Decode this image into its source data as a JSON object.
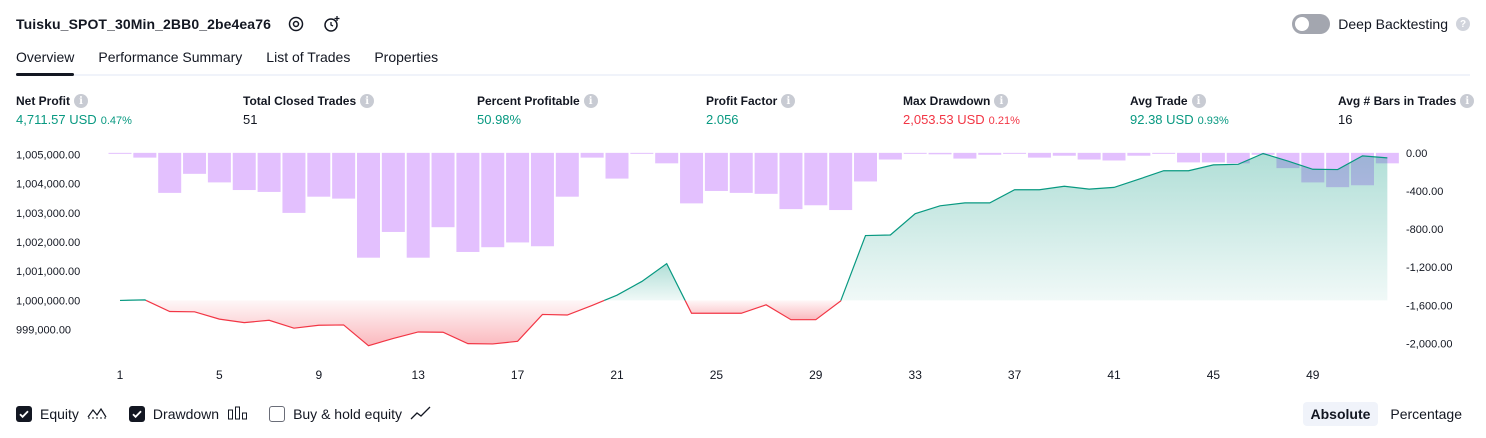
{
  "header": {
    "title": "Tuisku_SPOT_30Min_2BB0_2be4ea76",
    "deep_backtesting_label": "Deep Backtesting",
    "help_glyph": "?"
  },
  "tabs": [
    {
      "label": "Overview",
      "active": true
    },
    {
      "label": "Performance Summary"
    },
    {
      "label": "List of Trades"
    },
    {
      "label": "Properties"
    }
  ],
  "info_glyph": "i",
  "metrics": [
    {
      "label": "Net Profit",
      "value": "4,711.57 USD",
      "pct": "0.47%",
      "tone": "green"
    },
    {
      "label": "Total Closed Trades",
      "value": "51",
      "pct": "",
      "tone": "dark"
    },
    {
      "label": "Percent Profitable",
      "value": "50.98%",
      "pct": "",
      "tone": "green"
    },
    {
      "label": "Profit Factor",
      "value": "2.056",
      "pct": "",
      "tone": "green"
    },
    {
      "label": "Max Drawdown",
      "value": "2,053.53 USD",
      "pct": "0.21%",
      "tone": "red"
    },
    {
      "label": "Avg Trade",
      "value": "92.38 USD",
      "pct": "0.93%",
      "tone": "green"
    },
    {
      "label": "Avg # Bars in Trades",
      "value": "16",
      "pct": "",
      "tone": "dark"
    }
  ],
  "legend": {
    "equity": "Equity",
    "drawdown": "Drawdown",
    "buy_hold": "Buy & hold equity"
  },
  "modes": {
    "absolute": "Absolute",
    "percentage": "Percentage"
  },
  "colors": {
    "profit": "#089981",
    "loss": "#f23645",
    "drawdown_bar": "#ce93fe",
    "text": "#131722"
  },
  "chart_data": {
    "type": "line",
    "title": "",
    "x_ticks": [
      "1",
      "5",
      "9",
      "13",
      "17",
      "21",
      "25",
      "29",
      "33",
      "37",
      "41",
      "45",
      "49"
    ],
    "left_axis": {
      "ticks": [
        "1,005,000.00",
        "1,004,000.00",
        "1,003,000.00",
        "1,002,000.00",
        "1,001,000.00",
        "1,000,000.00",
        "999,000.00"
      ],
      "range": [
        998200,
        1005150
      ],
      "baseline": 1000000
    },
    "right_axis": {
      "ticks": [
        "0.00",
        "-400.00",
        "-800.00",
        "-1,200.00",
        "-1,600.00",
        "-2,000.00"
      ],
      "range": [
        -2100,
        30
      ]
    },
    "series": [
      {
        "name": "Equity",
        "axis": "left",
        "x": [
          1,
          2,
          3,
          4,
          5,
          6,
          7,
          8,
          9,
          10,
          11,
          12,
          13,
          14,
          15,
          16,
          17,
          18,
          19,
          20,
          21,
          22,
          23,
          24,
          25,
          26,
          27,
          28,
          29,
          30,
          31,
          32,
          33,
          34,
          35,
          36,
          37,
          38,
          39,
          40,
          41,
          42,
          43,
          44,
          45,
          46,
          47,
          48,
          49,
          50,
          51,
          52
        ],
        "values": [
          1000000,
          1000020,
          999620,
          999610,
          999360,
          999240,
          999320,
          999050,
          999150,
          999160,
          998450,
          998700,
          998920,
          998910,
          998520,
          998510,
          998600,
          999520,
          999500,
          999830,
          1000180,
          1000650,
          1001260,
          999560,
          999560,
          999560,
          999850,
          999340,
          999340,
          999980,
          1002220,
          1002240,
          1002970,
          1003240,
          1003340,
          1003340,
          1003790,
          1003790,
          1003910,
          1003810,
          1003870,
          1004150,
          1004440,
          1004440,
          1004640,
          1004660,
          1005030,
          1004770,
          1004490,
          1004480,
          1004950,
          1004880
        ]
      },
      {
        "name": "Drawdown",
        "axis": "right",
        "type": "bar",
        "x": [
          1,
          2,
          3,
          4,
          5,
          6,
          7,
          8,
          9,
          10,
          11,
          12,
          13,
          14,
          15,
          16,
          17,
          18,
          19,
          20,
          21,
          22,
          23,
          24,
          25,
          26,
          27,
          28,
          29,
          30,
          31,
          32,
          33,
          34,
          35,
          36,
          37,
          38,
          39,
          40,
          41,
          42,
          43,
          44,
          45,
          46,
          47,
          48,
          49,
          50,
          51,
          52
        ],
        "values": [
          0,
          -50,
          -420,
          -220,
          -310,
          -390,
          -410,
          -630,
          -460,
          -480,
          -1100,
          -830,
          -1100,
          -780,
          -1040,
          -990,
          -940,
          -980,
          -460,
          -50,
          -270,
          -5,
          -110,
          -530,
          -400,
          -420,
          -430,
          -590,
          -550,
          -600,
          -300,
          -70,
          0,
          -15,
          -60,
          -20,
          -10,
          -50,
          -30,
          -70,
          -80,
          -30,
          -5,
          -100,
          -100,
          -110,
          -20,
          -160,
          -310,
          -360,
          -340,
          -110
        ]
      }
    ]
  }
}
